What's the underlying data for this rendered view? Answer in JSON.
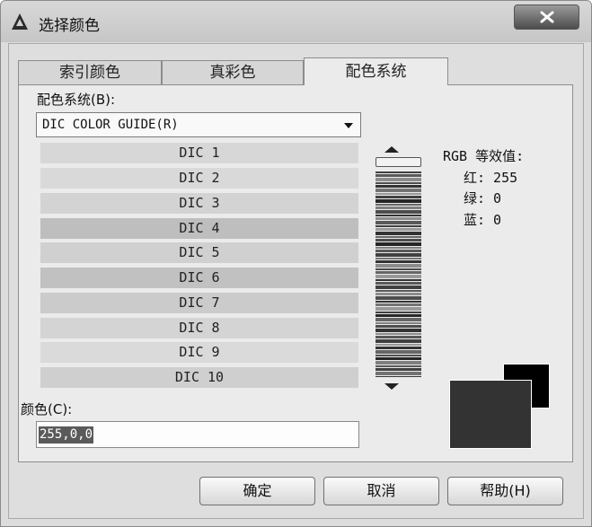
{
  "window": {
    "title": "选择颜色"
  },
  "tabs": [
    {
      "label": "索引颜色"
    },
    {
      "label": "真彩色"
    },
    {
      "label": "配色系统",
      "active": true
    }
  ],
  "color_system": {
    "label": "配色系统(B):",
    "selected": "DIC COLOR GUIDE(R)"
  },
  "color_guide_entries": [
    {
      "label": "DIC 1",
      "shade": "#d7d7d7"
    },
    {
      "label": "DIC 2",
      "shade": "#d9d9d9"
    },
    {
      "label": "DIC 3",
      "shade": "#d3d3d3"
    },
    {
      "label": "DIC 4",
      "shade": "#bebebe"
    },
    {
      "label": "DIC 5",
      "shade": "#d0d0d0"
    },
    {
      "label": "DIC 6",
      "shade": "#c1c1c1"
    },
    {
      "label": "DIC 7",
      "shade": "#cbcbcb"
    },
    {
      "label": "DIC 8",
      "shade": "#d4d4d4"
    },
    {
      "label": "DIC 9",
      "shade": "#dadada"
    },
    {
      "label": "DIC 10",
      "shade": "#cfcfcf"
    }
  ],
  "rgb": {
    "title": "RGB 等效值:",
    "red": "红: 255",
    "green": "绿: 0",
    "blue": "蓝: 0"
  },
  "color": {
    "label": "颜色(C):",
    "value": "255,0,0"
  },
  "swatches": {
    "previous": "#000000",
    "current": "#333333"
  },
  "buttons": {
    "ok": "确定",
    "cancel": "取消",
    "help": "帮助(H)"
  }
}
